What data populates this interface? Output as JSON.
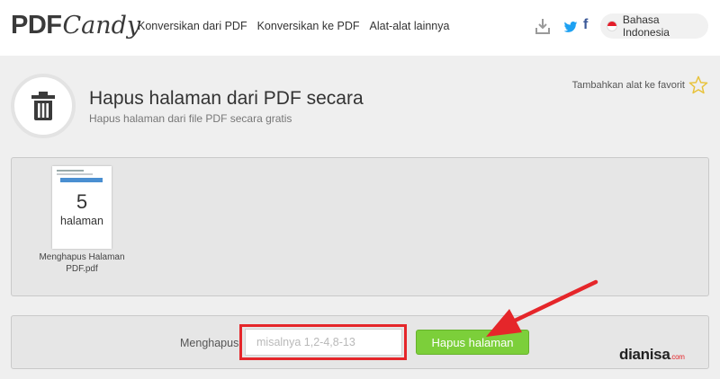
{
  "header": {
    "logo": {
      "pdf": "PDF",
      "candy": "Candy"
    },
    "nav": [
      "Konversikan dari PDF",
      "Konversikan ke PDF",
      "Alat-alat lainnya"
    ],
    "icons": [
      "download-icon",
      "twitter-icon",
      "facebook-icon"
    ],
    "facebook_glyph": "f",
    "language": "Bahasa Indonesia"
  },
  "tool": {
    "icon": "trash-icon",
    "title": "Hapus halaman dari PDF secara",
    "subtitle": "Hapus halaman dari file PDF secara gratis",
    "favorite_label": "Tambahkan alat ke favorit"
  },
  "file": {
    "page_count": "5",
    "page_unit": "halaman",
    "name": "Menghapus Halaman PDF.pdf"
  },
  "action": {
    "label": "Menghapus:",
    "input_value": "",
    "input_placeholder": "misalnya 1,2-4,8-13",
    "button_label": "Hapus halaman"
  },
  "watermark": {
    "name": "dianisa",
    "suffix": ".com"
  },
  "colors": {
    "accent_green": "#7ccf3a",
    "highlight_red": "#e5262a",
    "panel_bg": "#e6e6e6",
    "page_bg": "#efefef"
  }
}
